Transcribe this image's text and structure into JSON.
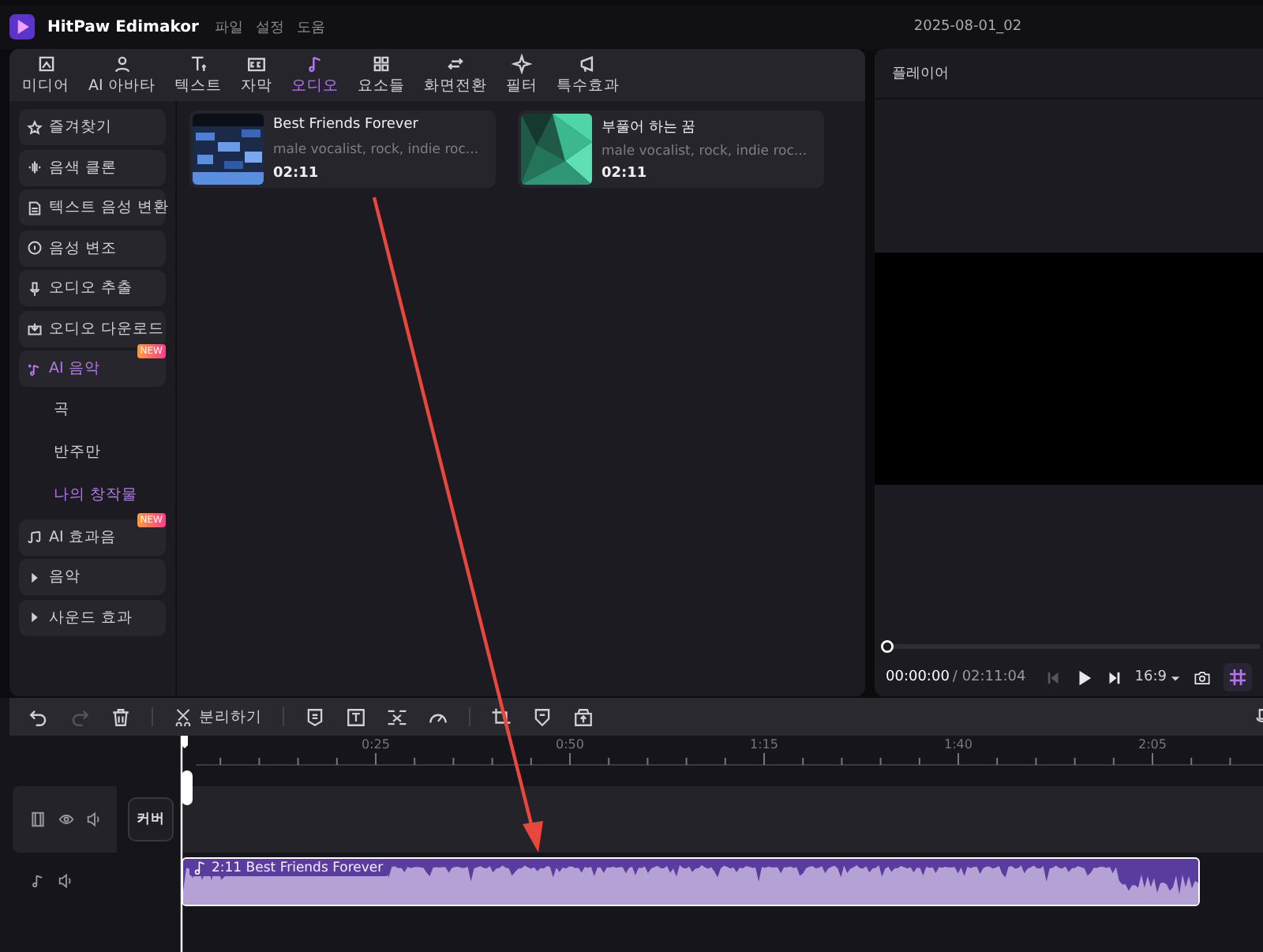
{
  "app": {
    "name": "HitPaw Edimakor",
    "menu": [
      "파일",
      "설정",
      "도움"
    ],
    "project": "2025-08-01_02"
  },
  "tabs": [
    {
      "label": "미디어",
      "selected": false
    },
    {
      "label": "AI 아바타",
      "selected": false
    },
    {
      "label": "텍스트",
      "selected": false
    },
    {
      "label": "자막",
      "selected": false
    },
    {
      "label": "오디오",
      "selected": true
    },
    {
      "label": "요소들",
      "selected": false
    },
    {
      "label": "화면전환",
      "selected": false
    },
    {
      "label": "필터",
      "selected": false
    },
    {
      "label": "특수효과",
      "selected": false
    }
  ],
  "sidebar": {
    "items": [
      {
        "label": "즐겨찾기",
        "selected": false
      },
      {
        "label": "음색 클론",
        "selected": false
      },
      {
        "label": "텍스트 음성 변환",
        "selected": false
      },
      {
        "label": "음성 변조",
        "selected": false
      },
      {
        "label": "오디오 추출",
        "selected": false
      },
      {
        "label": "오디오 다운로드",
        "selected": false
      },
      {
        "label": "AI 음악",
        "selected": true,
        "badge": "NEW",
        "children": [
          {
            "label": "곡",
            "selected": false
          },
          {
            "label": "반주만",
            "selected": false
          },
          {
            "label": "나의 창작물",
            "selected": true
          }
        ]
      },
      {
        "label": "AI 효과음",
        "selected": false,
        "badge": "NEW"
      },
      {
        "label": "음악",
        "selected": false,
        "expanded": false
      },
      {
        "label": "사운드 효과",
        "selected": false,
        "expanded": false
      }
    ]
  },
  "songs": [
    {
      "title": "Best Friends Forever",
      "tags": "male vocalist, rock, indie roc...",
      "duration": "02:11"
    },
    {
      "title": "부풀어 하는 꿈",
      "tags": "male vocalist, rock, indie roc...",
      "duration": "02:11"
    }
  ],
  "player": {
    "title": "플레이어",
    "time": "00:00:00",
    "total": "/ 02:11:04",
    "ratio": "16:9",
    "level": 0,
    "grid_on": true
  },
  "timeline": {
    "split_label": "분리하기",
    "redo_disabled": true,
    "ruler": [
      "0:25",
      "0:50",
      "1:15",
      "1:40",
      "2:05"
    ],
    "cover_label": "커버",
    "clip": {
      "label": "2:11 Best Friends Forever"
    }
  }
}
